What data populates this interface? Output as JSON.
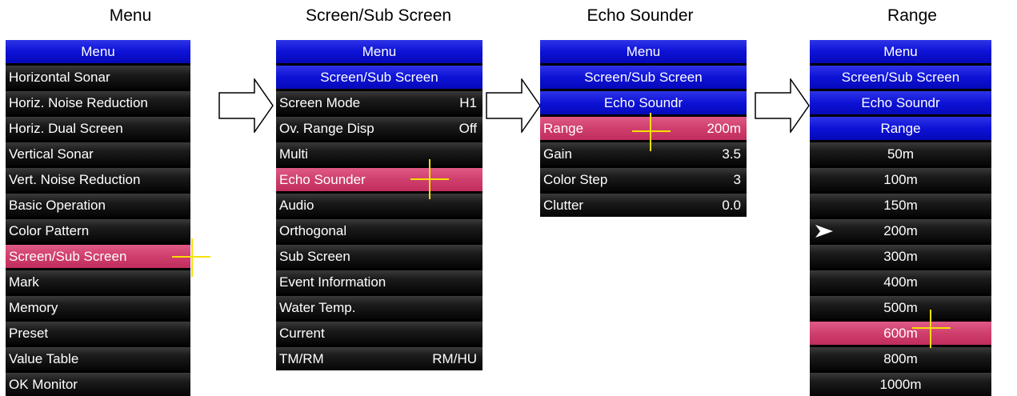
{
  "titles": {
    "menu": "Menu",
    "screen_sub": "Screen/Sub Screen",
    "echo": "Echo Sounder",
    "range": "Range"
  },
  "menu1": {
    "header": "Menu",
    "items": [
      "Horizontal Sonar",
      "Horiz. Noise Reduction",
      "Horiz. Dual Screen",
      "Vertical Sonar",
      "Vert. Noise Reduction",
      "Basic Operation",
      "Color Pattern",
      "Screen/Sub Screen",
      "Mark",
      "Memory",
      "Preset",
      "Value Table",
      "OK Monitor"
    ],
    "selected": "Screen/Sub Screen"
  },
  "menu2": {
    "headers": [
      "Menu",
      "Screen/Sub Screen"
    ],
    "items": [
      {
        "label": "Screen Mode",
        "value": "H1"
      },
      {
        "label": "Ov. Range Disp",
        "value": "Off"
      },
      {
        "label": "Multi",
        "value": ""
      },
      {
        "label": "Echo Sounder",
        "value": ""
      },
      {
        "label": "Audio",
        "value": ""
      },
      {
        "label": "Orthogonal",
        "value": ""
      },
      {
        "label": "Sub Screen",
        "value": ""
      },
      {
        "label": "Event Information",
        "value": ""
      },
      {
        "label": "Water Temp.",
        "value": ""
      },
      {
        "label": "Current",
        "value": ""
      },
      {
        "label": "TM/RM",
        "value": "RM/HU"
      }
    ],
    "selected": "Echo Sounder"
  },
  "menu3": {
    "headers": [
      "Menu",
      "Screen/Sub Screen",
      "Echo Soundr"
    ],
    "items": [
      {
        "label": "Range",
        "value": "200m"
      },
      {
        "label": "Gain",
        "value": "3.5"
      },
      {
        "label": "Color Step",
        "value": "3"
      },
      {
        "label": "Clutter",
        "value": "0.0"
      }
    ],
    "selected": "Range"
  },
  "menu4": {
    "headers": [
      "Menu",
      "Screen/Sub Screen",
      "Echo Soundr",
      "Range"
    ],
    "items": [
      "50m",
      "100m",
      "150m",
      "200m",
      "300m",
      "400m",
      "500m",
      "600m",
      "800m",
      "1000m"
    ],
    "current": "200m",
    "selected": "600m"
  },
  "colors": {
    "header_blue": "#0d12d6",
    "selected_pink": "#cf3f6d",
    "row_black": "#000000",
    "cursor_yellow": "#f5e100"
  },
  "icons": {
    "flow_arrow": "right-arrow-outline",
    "current_marker": "pointer-arrow-icon",
    "cursor": "crosshair-cursor"
  }
}
